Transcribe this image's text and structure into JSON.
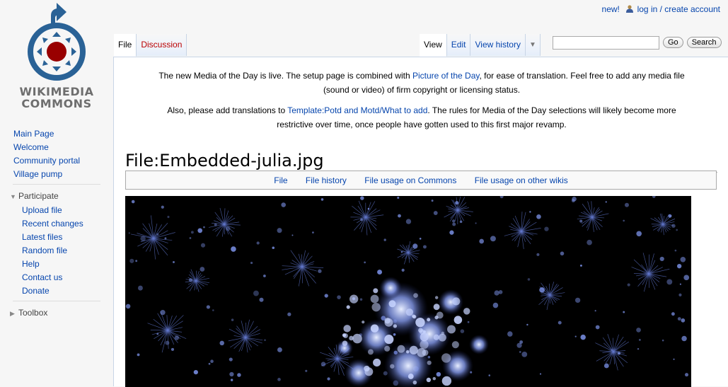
{
  "personal": {
    "new_label": "new!",
    "login_label": "log in / create account"
  },
  "logo": {
    "line1": "WIKIMEDIA",
    "line2": "COMMONS",
    "colors": {
      "blue": "#2a6296",
      "red": "#990000",
      "gray": "#6e6e6e"
    }
  },
  "nav": {
    "main_page": "Main Page",
    "welcome": "Welcome",
    "community_portal": "Community portal",
    "village_pump": "Village pump",
    "participate": "Participate",
    "participate_items": [
      "Upload file",
      "Recent changes",
      "Latest files",
      "Random file",
      "Help",
      "Contact us",
      "Donate"
    ],
    "toolbox": "Toolbox"
  },
  "tabs": {
    "file": "File",
    "discussion": "Discussion",
    "view": "View",
    "edit": "Edit",
    "view_history": "View history",
    "more_icon": "chevron-down-icon"
  },
  "search": {
    "value": "",
    "go": "Go",
    "search": "Search"
  },
  "notice": {
    "p1_before": "The new Media of the Day is live. The setup page is combined with ",
    "p1_link": "Picture of the Day",
    "p1_after_line1": ", for ease of translation. Feel free to add any media file",
    "p1_line2": "(sound or video) of firm copyright or licensing status.",
    "p2_before": "Also, please add translations to ",
    "p2_link": "Template:Potd and Motd/What to add",
    "p2_after_line1": ". The rules for Media of the Day selections will likely become more",
    "p2_line2": "restrictive over time, once people have gotten used to this first major revamp."
  },
  "page": {
    "title": "File:Embedded-julia.jpg"
  },
  "filetoc": [
    "File",
    "File history",
    "File usage on Commons",
    "File usage on other wikis"
  ],
  "colors": {
    "link": "#0645ad",
    "redlink": "#ba0000",
    "image_bg": "#000000",
    "fractal": "#8fa6ff"
  }
}
